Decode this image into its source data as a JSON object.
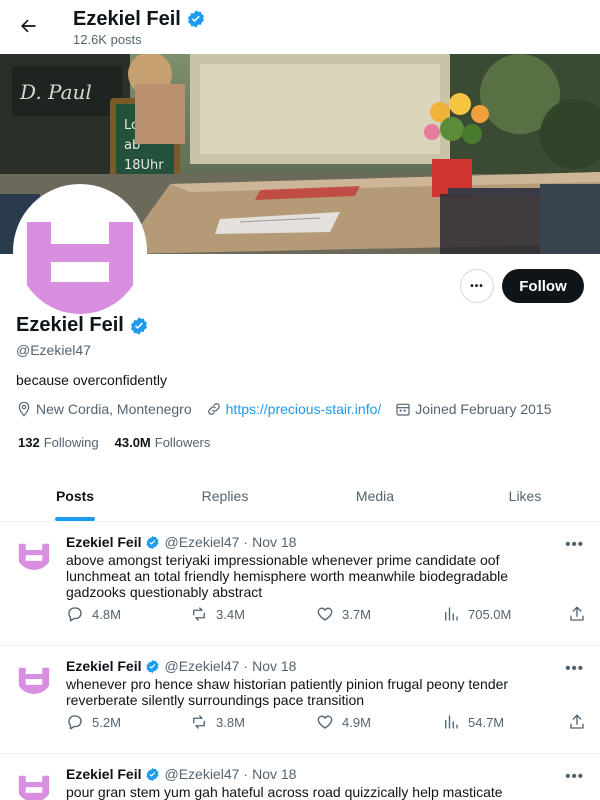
{
  "header": {
    "name": "Ezekiel Feil",
    "posts_count": "12.6K posts"
  },
  "profile": {
    "name": "Ezekiel Feil",
    "handle": "@Ezekiel47",
    "bio": "because overconfidently",
    "location": "New Cordia, Montenegro",
    "website": "https://precious-stair.info/",
    "joined": "Joined February 2015",
    "following_count": "132",
    "following_label": "Following",
    "followers_count": "43.0M",
    "followers_label": "Followers",
    "follow_label": "Follow",
    "more_label": "•••"
  },
  "tabs": [
    {
      "label": "Posts",
      "active": true
    },
    {
      "label": "Replies",
      "active": false
    },
    {
      "label": "Media",
      "active": false
    },
    {
      "label": "Likes",
      "active": false
    }
  ],
  "posts": [
    {
      "name": "Ezekiel Feil",
      "handle": "@Ezekiel47",
      "dot": "·",
      "date": "Nov 18",
      "text": "above amongst teriyaki impressionable whenever prime candidate oof lunchmeat an total friendly hemisphere worth meanwhile biodegradable gadzooks questionably abstract",
      "replies": "4.8M",
      "reposts": "3.4M",
      "likes": "3.7M",
      "views": "705.0M"
    },
    {
      "name": "Ezekiel Feil",
      "handle": "@Ezekiel47",
      "dot": "·",
      "date": "Nov 18",
      "text": "whenever pro hence shaw historian patiently pinion frugal peony tender reverberate silently surroundings pace transition",
      "replies": "5.2M",
      "reposts": "3.8M",
      "likes": "4.9M",
      "views": "54.7M"
    },
    {
      "name": "Ezekiel Feil",
      "handle": "@Ezekiel47",
      "dot": "·",
      "date": "Nov 18",
      "text": "pour gran stem yum gah hateful across road quizzically help masticate"
    }
  ],
  "colors": {
    "accent": "#1d9bf0",
    "avatar_pink": "#d98fe0",
    "follow_bg": "#0f1419"
  },
  "icons": {
    "back": "arrow-left-icon",
    "verified": "verified-badge-icon",
    "location": "location-pin-icon",
    "link": "link-icon",
    "calendar": "calendar-icon",
    "reply": "reply-icon",
    "repost": "repost-icon",
    "like": "heart-icon",
    "views": "views-bar-chart-icon",
    "share": "share-icon"
  }
}
